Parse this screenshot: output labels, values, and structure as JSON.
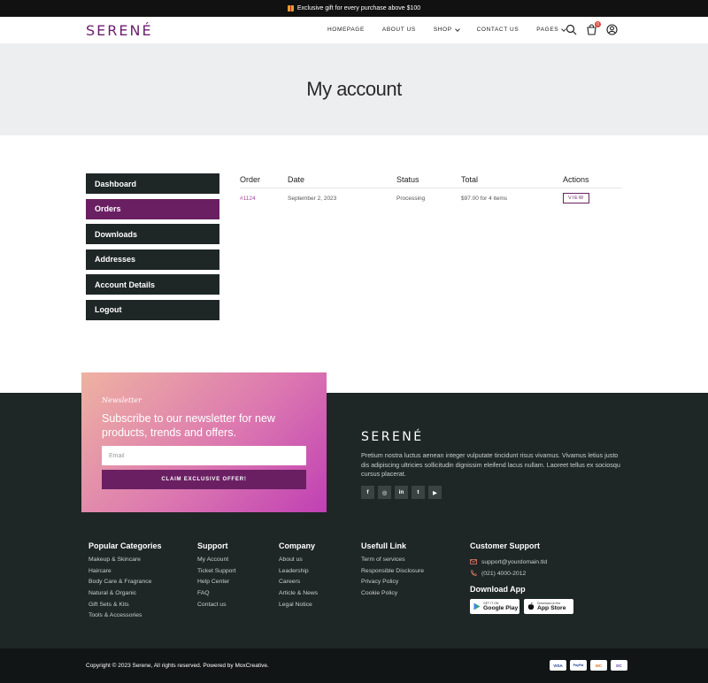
{
  "topbar": {
    "text": "Exclusive gift for every purchase above $100",
    "icon": "gift-icon"
  },
  "header": {
    "logo": "SERENÉ",
    "nav": [
      {
        "label": "HOMEPAGE"
      },
      {
        "label": "ABOUT US"
      },
      {
        "label": "SHOP"
      },
      {
        "label": "CONTACT US"
      },
      {
        "label": "PAGES"
      }
    ],
    "cart_count": "0"
  },
  "banner": {
    "title": "My account"
  },
  "sidebar": {
    "items": [
      {
        "label": "Dashboard"
      },
      {
        "label": "Orders"
      },
      {
        "label": "Downloads"
      },
      {
        "label": "Addresses"
      },
      {
        "label": "Account Details"
      },
      {
        "label": "Logout"
      }
    ],
    "active_index": 1
  },
  "orders": {
    "columns": [
      "Order",
      "Date",
      "Status",
      "Total",
      "Actions"
    ],
    "rows": [
      {
        "order": "#1124",
        "date": "September 2, 2023",
        "status": "Processing",
        "total": "$97.00 for 4 items",
        "action": "VIEW"
      }
    ]
  },
  "newsletter": {
    "tag": "Newsletter",
    "heading": "Subscribe to our newsletter for new products, trends and offers.",
    "email_placeholder": "Email",
    "button": "CLAIM EXCLUSIVE OFFER!"
  },
  "footer_brand": {
    "logo": "SERENÉ",
    "description": "Pretium nostra luctus aenean integer vulputate tincidunt risus vivamus. Vivamus letius justo dis adipiscing ultricies sollicitudin dignissim eleifend lacus nullam. Laoreet tellus ex sociosqu cursus placerat.",
    "socials": [
      "f",
      "◎",
      "in",
      "t",
      "▶"
    ]
  },
  "footer_columns": [
    {
      "title": "Popular Categories",
      "links": [
        "Makeup & Skincare",
        "Haircare",
        "Body Care & Fragrance",
        "Natural & Organic",
        "Gift Sets & Kits",
        "Tools & Accessories"
      ]
    },
    {
      "title": "Support",
      "links": [
        "My Account",
        "Ticket Support",
        "Help Center",
        "FAQ",
        "Contact us"
      ]
    },
    {
      "title": "Company",
      "links": [
        "About us",
        "Leadership",
        "Careers",
        "Article & News",
        "Legal Notice"
      ]
    },
    {
      "title": "Usefull Link",
      "links": [
        "Term of services",
        "Responsible Disclosure",
        "Privacy Policy",
        "Cookie Policy"
      ]
    }
  ],
  "customer_support": {
    "title": "Customer Support",
    "email": "support@yourdomain.tld",
    "phone": "(021) 4000-2012",
    "download_title": "Download App",
    "google_small": "GET IT ON",
    "google_big": "Google Play",
    "apple_small": "Download on the",
    "apple_big": "App Store"
  },
  "bottom": {
    "copyright": "Copyright © 2023 Serene, All rights reserved. Powered by MoxCreative.",
    "payments": [
      "VISA",
      "PayPal",
      "MC",
      "DC"
    ]
  },
  "colors": {
    "accent": "#6a1f63",
    "dark": "#1f2626",
    "topbar": "#111111"
  }
}
